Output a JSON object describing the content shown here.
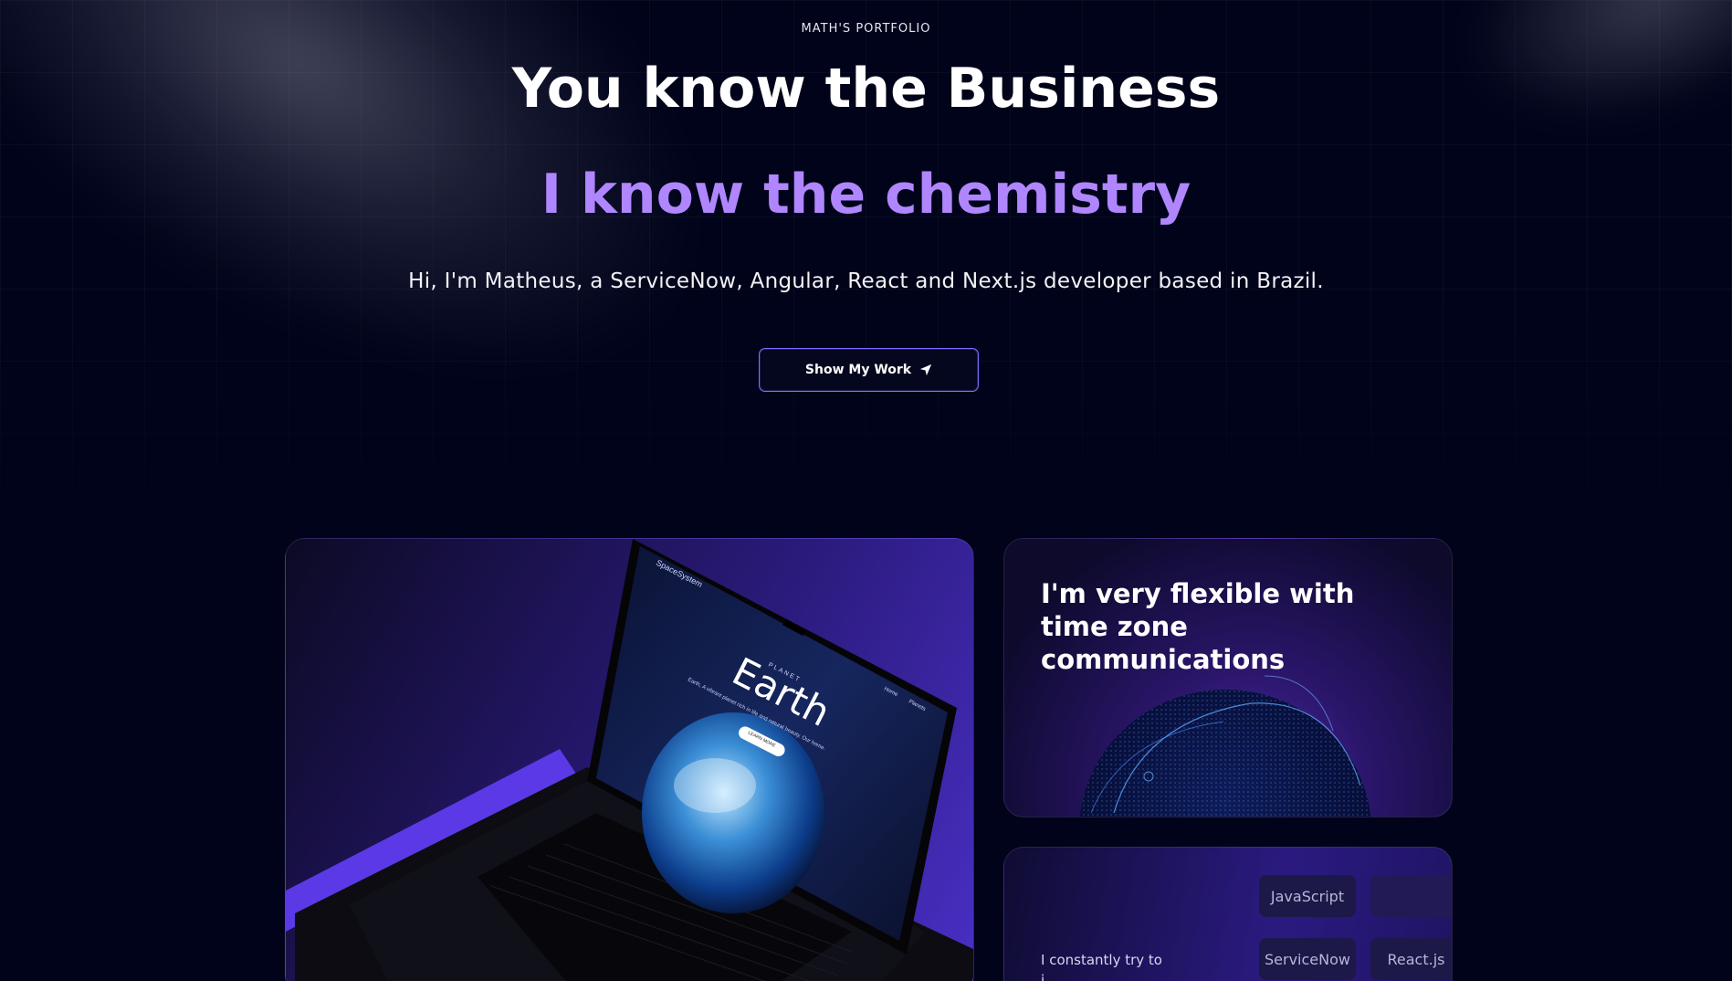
{
  "hero": {
    "eyebrow": "MATH'S PORTFOLIO",
    "title_line1": "You know the Business",
    "title_line2": "I know the chemistry",
    "subtitle": "Hi, I'm Matheus, a ServiceNow, Angular, React and Next.js developer based in Brazil.",
    "cta_label": "Show My Work",
    "cta_icon": "location-arrow-icon"
  },
  "cards": {
    "laptop": {
      "screen_brand": "SpaceSystem",
      "screen_kicker": "PLANET",
      "screen_title": "Earth",
      "screen_desc": "Earth, A vibrant planet rich in life and natural beauty. Our home.",
      "screen_button": "LEARN MORE",
      "screen_nav_home": "Home",
      "screen_nav_planets": "Planets"
    },
    "timezone": {
      "heading": "I'm very flexible with time zone communications"
    },
    "stack": {
      "text_line1": "I constantly try to",
      "text_line2": "i",
      "chips": [
        "JavaScript",
        "",
        "ServiceNow",
        "React.js"
      ]
    }
  },
  "colors": {
    "background": "#000319",
    "accent_purple": "#b086ff",
    "button_border": "#7a6dff"
  }
}
